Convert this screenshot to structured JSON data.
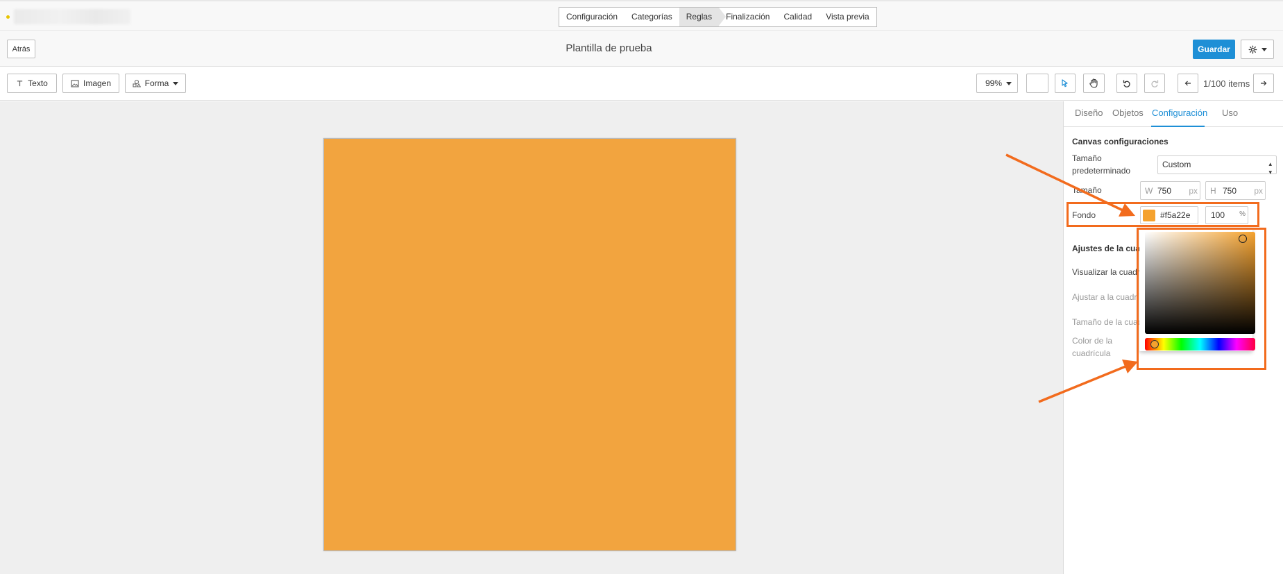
{
  "topbar": {
    "steps": [
      {
        "label": "Configuración",
        "active": false
      },
      {
        "label": "Categorías",
        "active": false
      },
      {
        "label": "Reglas",
        "active": true
      },
      {
        "label": "Finalización",
        "active": false
      },
      {
        "label": "Calidad",
        "active": false
      },
      {
        "label": "Vista previa",
        "active": false
      }
    ]
  },
  "titlebar": {
    "back_label": "Atrás",
    "title": "Plantilla de prueba",
    "save_label": "Guardar"
  },
  "toolbar": {
    "text_label": "Texto",
    "image_label": "Imagen",
    "shape_label": "Forma",
    "zoom": "99%",
    "item_counter": "1/100 items"
  },
  "canvas": {
    "background": "#f2a43f"
  },
  "panel": {
    "tabs": [
      {
        "label": "Diseño",
        "active": false
      },
      {
        "label": "Objetos",
        "active": false
      },
      {
        "label": "Configuración",
        "active": true
      },
      {
        "label": "Uso",
        "active": false
      }
    ],
    "canvas_section": "Canvas configuraciones",
    "default_size_label": "Tamaño predeterminado",
    "default_size_value": "Custom",
    "size_label": "Tamaño",
    "width_prefix": "W",
    "width": "750",
    "height_prefix": "H",
    "height": "750",
    "unit": "px",
    "background_label": "Fondo",
    "background_hex": "#f5a22e",
    "background_opacity": "100",
    "opacity_unit": "%",
    "grid_section": "Ajustes de la cuadrícula",
    "grid_show": "Visualizar la cuadrícula",
    "grid_snap": "Ajustar a la cuadrícula",
    "grid_size": "Tamaño de la cuadrícula",
    "grid_color": "Color de la cuadrícula"
  },
  "picker": {
    "hue_color": "#f5a22e"
  },
  "colors": {
    "accent": "#1e8fd6",
    "annotation": "#f26b1d"
  }
}
